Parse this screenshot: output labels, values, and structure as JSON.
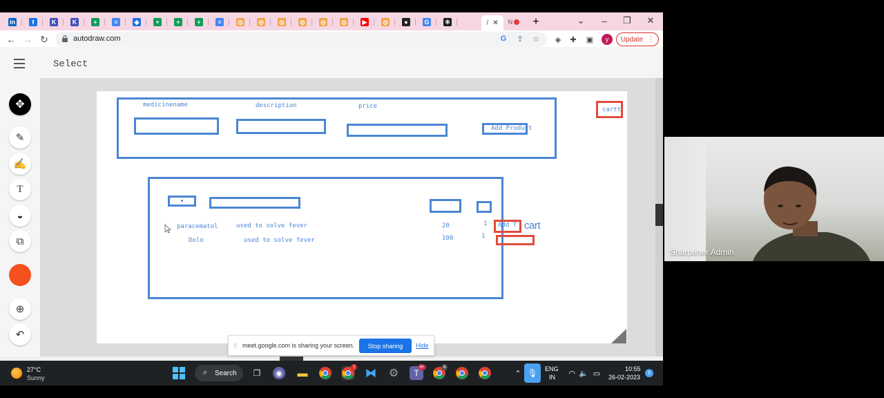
{
  "browser": {
    "tabs": [
      {
        "icon": "linkedin-icon",
        "glyph": "in",
        "color": "#0a66c2"
      },
      {
        "icon": "upload-icon",
        "glyph": "⭱",
        "color": "#1a73e8"
      },
      {
        "icon": "k-icon",
        "glyph": "K",
        "color": "#3f51b5"
      },
      {
        "icon": "k-icon",
        "glyph": "K",
        "color": "#3f51b5"
      },
      {
        "icon": "sheets-icon",
        "glyph": "+",
        "color": "#0f9d58"
      },
      {
        "icon": "docs-icon",
        "glyph": "≡",
        "color": "#4285f4"
      },
      {
        "icon": "diamond-icon",
        "glyph": "◆",
        "color": "#1a73e8"
      },
      {
        "icon": "sheets-icon",
        "glyph": "+",
        "color": "#0f9d58"
      },
      {
        "icon": "sheets-icon",
        "glyph": "+",
        "color": "#0f9d58"
      },
      {
        "icon": "sheets-icon",
        "glyph": "+",
        "color": "#0f9d58"
      },
      {
        "icon": "docs-icon",
        "glyph": "≡",
        "color": "#4285f4"
      },
      {
        "icon": "orange-badge-icon",
        "glyph": "◎",
        "color": "#f2a24a"
      },
      {
        "icon": "orange-badge-icon",
        "glyph": "◎",
        "color": "#f2a24a"
      },
      {
        "icon": "orange-badge-icon",
        "glyph": "◎",
        "color": "#f2a24a"
      },
      {
        "icon": "orange-badge-icon",
        "glyph": "◎",
        "color": "#f2a24a"
      },
      {
        "icon": "orange-badge-icon",
        "glyph": "◎",
        "color": "#f2a24a"
      },
      {
        "icon": "orange-badge-icon",
        "glyph": "◎",
        "color": "#f2a24a"
      },
      {
        "icon": "youtube-icon",
        "glyph": "▶",
        "color": "#ff0000"
      },
      {
        "icon": "orange-badge-icon",
        "glyph": "◎",
        "color": "#f2a24a"
      },
      {
        "icon": "github-icon",
        "glyph": "●",
        "color": "#222222"
      },
      {
        "icon": "google-icon",
        "glyph": "G",
        "color": "#4285f4"
      },
      {
        "icon": "react-icon",
        "glyph": "⚛",
        "color": "#1e1e1e"
      }
    ],
    "active_tab_glyph": "/",
    "extra_tab_glyph": "N",
    "url": "autodraw.com",
    "update_label": "Update",
    "avatar_letter": "y"
  },
  "app": {
    "mode": "Select"
  },
  "canvas": {
    "form_labels": [
      "medicinename",
      "description",
      "price"
    ],
    "add_button_label": "Add Product",
    "cart_label": "cartt",
    "rows": [
      {
        "name": "paracematol",
        "description": "used to solve fever",
        "price": "20",
        "qty": "1"
      },
      {
        "name": "Dolo",
        "description": "used to solve fever",
        "price": "100",
        "qty": "1"
      }
    ],
    "scribble_label": "cart",
    "scribble_box_label": "Add T"
  },
  "share_bar": {
    "message": "meet.google.com is sharing your screen.",
    "stop_label": "Stop sharing",
    "hide_label": "Hide"
  },
  "video": {
    "participant": "Sharpener Admin"
  },
  "taskbar": {
    "temperature": "27°C",
    "condition": "Sunny",
    "search_label": "Search",
    "lang_top": "ENG",
    "lang_bottom": "IN",
    "time": "10:55",
    "date": "26-02-2023",
    "notification_count": "5",
    "badge_counts": [
      "7",
      "9+",
      "4"
    ]
  }
}
